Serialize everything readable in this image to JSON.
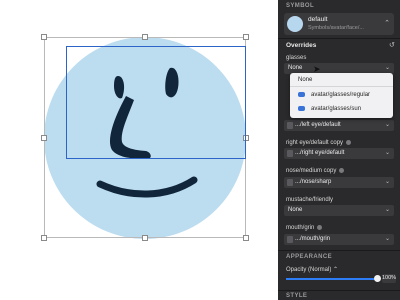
{
  "canvas": {
    "face_color": "#bcdcf0",
    "feature_color": "#11263a",
    "highlight_color": "#2d64c8"
  },
  "inspector": {
    "symbol_header": "SYMBOL",
    "symbol_name": "default",
    "symbol_path": "Symbols/avatar/face/...",
    "overrides_title": "Overrides",
    "overrides": [
      {
        "label": "glasses",
        "value": "None"
      },
      {
        "label": "",
        "value": ".../left eye/default"
      },
      {
        "label": "right eye/default copy",
        "value": ".../right eye/default"
      },
      {
        "label": "nose/medium copy",
        "value": ".../nose/sharp"
      },
      {
        "label": "mustache/friendly",
        "value": "None"
      },
      {
        "label": "mouth/grin",
        "value": ".../mouth/grin"
      }
    ],
    "dropdown": {
      "items": [
        "None",
        "avatar/glasses/regular",
        "avatar/glasses/sun"
      ]
    },
    "appearance_header": "APPEARANCE",
    "opacity_label": "Opacity (Normal)",
    "opacity_value": "100%",
    "opacity_fraction": 1.0,
    "style_header": "STYLE"
  }
}
